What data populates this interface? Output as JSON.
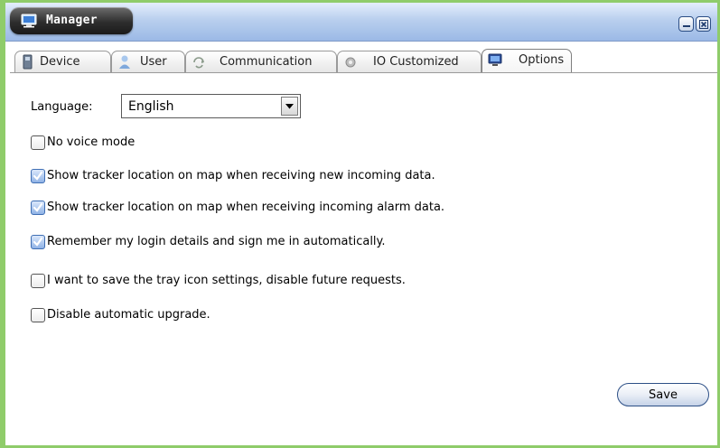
{
  "window": {
    "title": "Manager",
    "accent": "#8fcc6a",
    "titlebar_color": "#b9cfee",
    "icons": [
      "computer-icon",
      "minimize-icon",
      "close-icon"
    ]
  },
  "tabs": [
    {
      "label": "Device",
      "icon": "device-icon",
      "active": false
    },
    {
      "label": "User",
      "icon": "user-icon",
      "active": false
    },
    {
      "label": "Communication",
      "icon": "communication-icon",
      "active": false
    },
    {
      "label": "IO Customized",
      "icon": "gear-icon",
      "active": false
    },
    {
      "label": "Options",
      "icon": "monitor-icon",
      "active": true
    }
  ],
  "options": {
    "language": {
      "label": "Language:",
      "value": "English"
    },
    "checkboxes": [
      {
        "label": "No voice mode",
        "checked": false
      },
      {
        "label": "Show tracker location on map when receiving new incoming data.",
        "checked": true
      },
      {
        "label": "Show tracker location on map when receiving incoming alarm data.",
        "checked": true
      },
      {
        "label": "Remember my login details and sign me in automatically.",
        "checked": true
      },
      {
        "label": "I want to save the tray icon settings, disable future requests.",
        "checked": false
      },
      {
        "label": "Disable automatic upgrade.",
        "checked": false
      }
    ],
    "save_label": "Save"
  }
}
